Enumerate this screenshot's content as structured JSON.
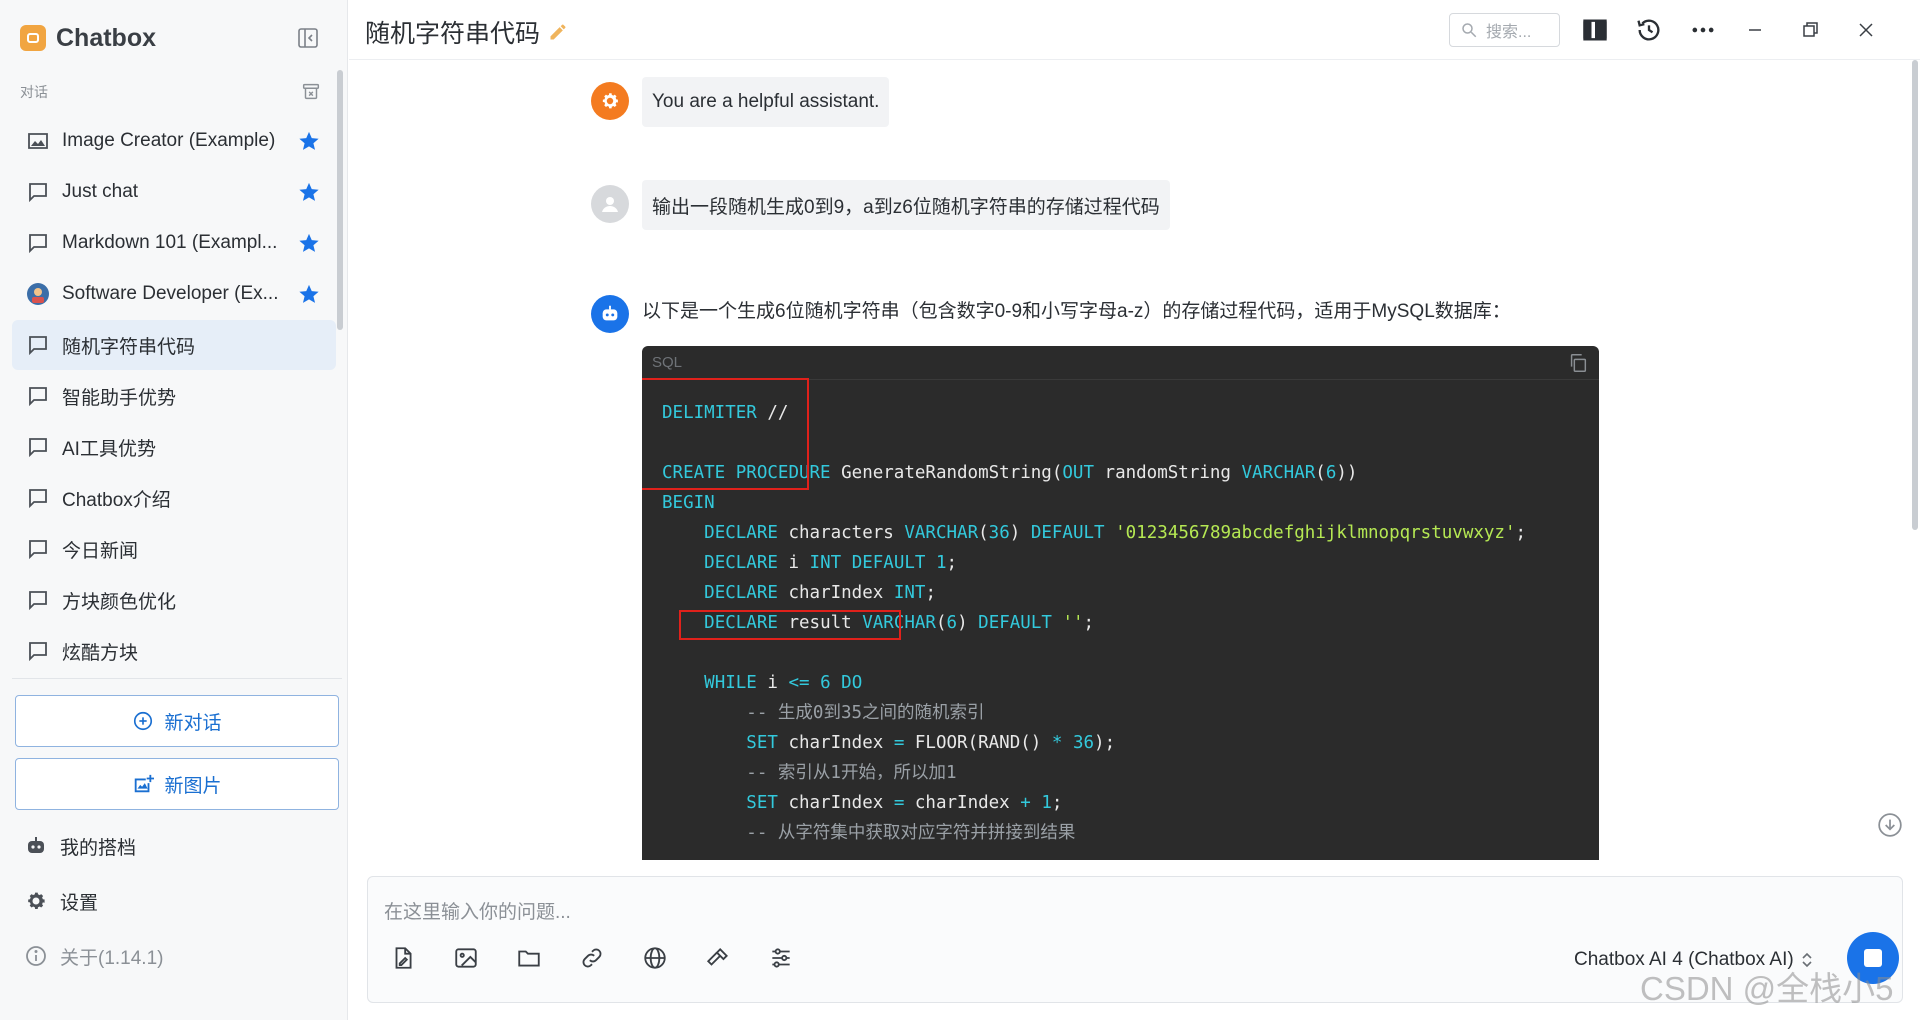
{
  "app": {
    "name": "Chatbox"
  },
  "sidebar": {
    "section_label": "对话",
    "conversations": [
      {
        "label": "Image Creator (Example)",
        "icon": "image-icon",
        "starred": true
      },
      {
        "label": "Just chat",
        "icon": "chat-icon",
        "starred": true
      },
      {
        "label": "Markdown 101 (Exampl...",
        "icon": "chat-icon",
        "starred": true
      },
      {
        "label": "Software Developer (Ex...",
        "icon": "developer-avatar-icon",
        "starred": true
      },
      {
        "label": "随机字符串代码",
        "icon": "chat-icon",
        "starred": false,
        "active": true
      },
      {
        "label": "智能助手优势",
        "icon": "chat-icon",
        "starred": false
      },
      {
        "label": "AI工具优势",
        "icon": "chat-icon",
        "starred": false
      },
      {
        "label": "Chatbox介绍",
        "icon": "chat-icon",
        "starred": false
      },
      {
        "label": "今日新闻",
        "icon": "chat-icon",
        "starred": false
      },
      {
        "label": "方块颜色优化",
        "icon": "chat-icon",
        "starred": false
      },
      {
        "label": "炫酷方块",
        "icon": "chat-icon",
        "starred": false
      }
    ],
    "new_chat_label": "新对话",
    "new_image_label": "新图片",
    "my_partners_label": "我的搭档",
    "settings_label": "设置",
    "about_label": "关于(1.14.1)"
  },
  "header": {
    "title": "随机字符串代码",
    "search_placeholder": "搜索..."
  },
  "messages": {
    "system": "You are a helpful assistant.",
    "user": "输出一段随机生成0到9，a到z6位随机字符串的存储过程代码",
    "assistant_intro": "以下是一个生成6位随机字符串（包含数字0-9和小写字母a-z）的存储过程代码，适用于MySQL数据库：",
    "code_language": "SQL"
  },
  "composer": {
    "placeholder": "在这里输入你的问题...",
    "model": "Chatbox AI 4 (Chatbox AI)"
  },
  "watermark": "CSDN @全栈小5",
  "colors": {
    "accent": "#1a73e8",
    "code_bg": "#2b2b2b",
    "keyword": "#33c9dc",
    "string": "#b5e853",
    "annotation_red": "#e0211b",
    "system_avatar": "#f47b20"
  }
}
